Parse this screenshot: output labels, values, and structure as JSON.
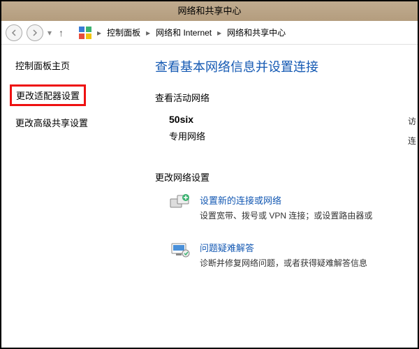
{
  "window": {
    "title": "网络和共享中心"
  },
  "breadcrumb": {
    "items": [
      "控制面板",
      "网络和 Internet",
      "网络和共享中心"
    ]
  },
  "sidebar": {
    "home": "控制面板主页",
    "adapter": "更改适配器设置",
    "advanced": "更改高级共享设置"
  },
  "main": {
    "heading": "查看基本网络信息并设置连接",
    "active_label": "查看活动网络",
    "network": {
      "name": "50six",
      "type": "专用网络"
    },
    "right_hint1": "访",
    "right_hint2": "连",
    "change_label": "更改网络设置",
    "opt1": {
      "title": "设置新的连接或网络",
      "desc": "设置宽带、拨号或 VPN 连接；或设置路由器或"
    },
    "opt2": {
      "title": "问题疑难解答",
      "desc": "诊断并修复网络问题，或者获得疑难解答信息"
    }
  }
}
